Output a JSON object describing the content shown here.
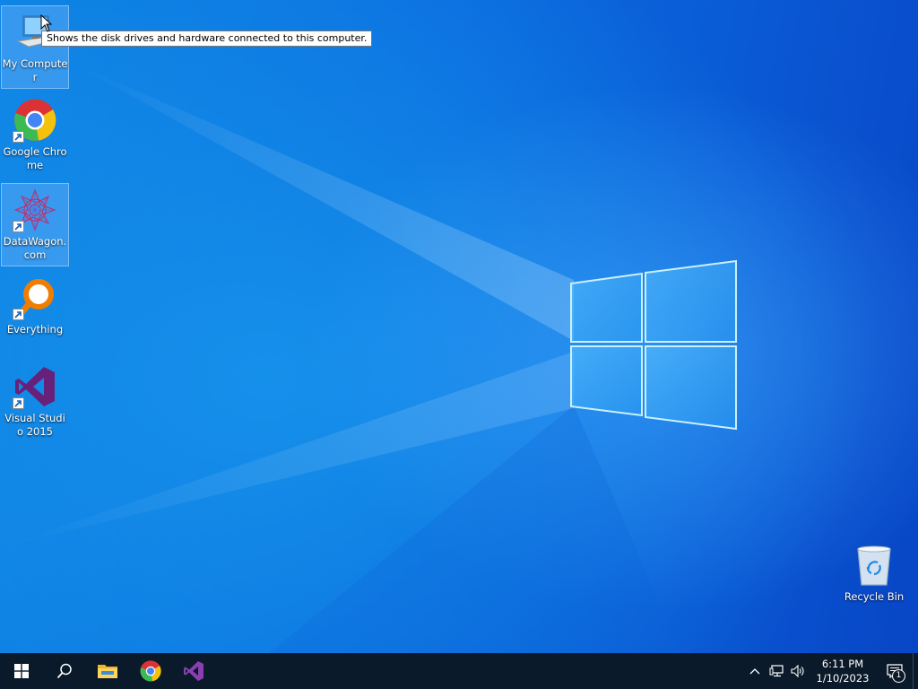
{
  "desktop": {
    "icons": [
      {
        "label": "My Computer",
        "icon": "computer-icon",
        "selected": true
      },
      {
        "label": "Google Chrome",
        "icon": "chrome-icon",
        "selected": false
      },
      {
        "label": "DataWagon.com",
        "icon": "datawagon-icon",
        "selected": true
      },
      {
        "label": "Everything",
        "icon": "everything-search-icon",
        "selected": false
      },
      {
        "label": "Visual Studio 2015",
        "icon": "visual-studio-icon",
        "selected": false
      },
      {
        "label": "Recycle Bin",
        "icon": "recycle-bin-icon",
        "selected": false
      }
    ],
    "tooltip": "Shows the disk drives and hardware connected to this computer."
  },
  "taskbar": {
    "pinned": [
      {
        "name": "start",
        "icon": "windows-logo-icon"
      },
      {
        "name": "search",
        "icon": "search-icon"
      },
      {
        "name": "file-explorer",
        "icon": "folder-icon"
      },
      {
        "name": "chrome",
        "icon": "chrome-icon"
      },
      {
        "name": "visual-studio",
        "icon": "visual-studio-icon"
      }
    ],
    "tray": {
      "time": "6:11 PM",
      "date": "1/10/2023",
      "notification_count": "1",
      "icons": [
        "chevron-up-icon",
        "network-icon",
        "volume-icon",
        "notification-icon"
      ]
    }
  },
  "colors": {
    "desktop_blue": "#0b6ddf",
    "taskbar": "#0b1a2a",
    "vs_purple": "#68217a"
  }
}
